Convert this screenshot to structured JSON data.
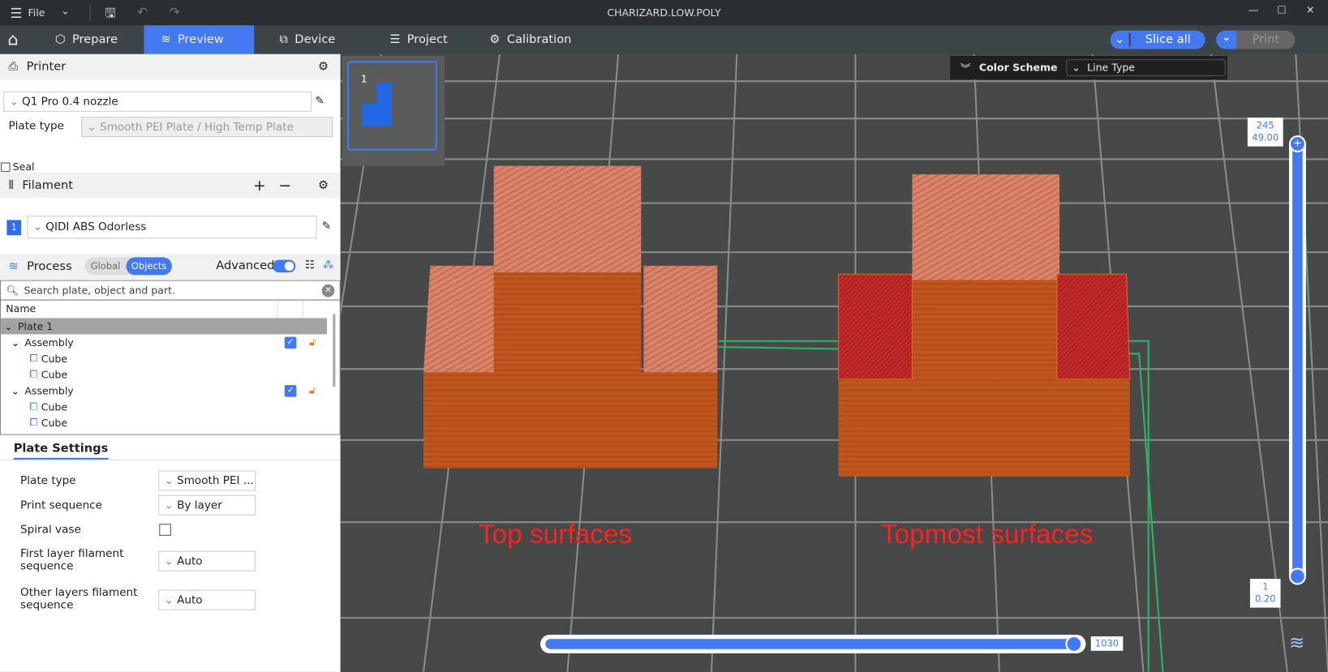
{
  "titlebar": {
    "file_label": "File",
    "title": "CHARIZARD.LOW.POLY"
  },
  "tabs": [
    {
      "label": "Prepare"
    },
    {
      "label": "Preview"
    },
    {
      "label": "Device"
    },
    {
      "label": "Project"
    },
    {
      "label": "Calibration"
    }
  ],
  "actions": {
    "slice_label": "Slice all",
    "print_label": "Print"
  },
  "printer": {
    "header": "Printer",
    "preset": "Q1 Pro 0.4 nozzle",
    "plate_type_label": "Plate type",
    "plate_type": "Smooth PEI Plate / High Temp Plate",
    "seal_label": "Seal"
  },
  "filament": {
    "header": "Filament",
    "index": "1",
    "name": "QIDI ABS Odorless"
  },
  "process": {
    "header": "Process",
    "global_label": "Global",
    "objects_label": "Objects",
    "advanced_label": "Advanced",
    "search_placeholder": "Search plate, object and part."
  },
  "tree": {
    "column_name": "Name",
    "plate": "Plate 1",
    "rows": [
      {
        "label": "Assembly",
        "level": 1
      },
      {
        "label": "Cube",
        "level": 2
      },
      {
        "label": "Cube",
        "level": 2
      },
      {
        "label": "Assembly",
        "level": 1
      },
      {
        "label": "Cube",
        "level": 2
      },
      {
        "label": "Cube",
        "level": 2
      }
    ]
  },
  "plate_settings": {
    "tab": "Plate Settings",
    "plate_type_label": "Plate type",
    "plate_type": "Smooth PEI ...",
    "print_sequence_label": "Print sequence",
    "print_sequence": "By layer",
    "spiral_vase_label": "Spiral vase",
    "first_layer_label": "First layer filament sequence",
    "first_layer": "Auto",
    "other_layers_label": "Other layers filament sequence",
    "other_layers": "Auto"
  },
  "viewport": {
    "plate_number": "1",
    "color_scheme_label": "Color Scheme",
    "color_scheme": "Line Type",
    "label_left": "Top surfaces",
    "label_right": "Topmost surfaces",
    "layer_top": "245",
    "height_top": "49.00",
    "layer_bottom": "1",
    "height_bottom": "0.20",
    "move_value": "1030",
    "move_progress": 1.0
  },
  "colors": {
    "accent": "#4479f2",
    "annotation": "#ff2020",
    "wall": "#c0561e",
    "top_surface": "#d98468",
    "topmost_surface": "#c42a2a",
    "travel": "#2fb36a"
  }
}
